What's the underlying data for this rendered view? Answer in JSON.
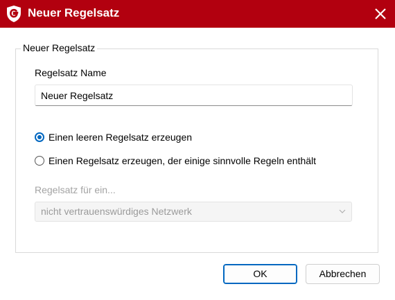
{
  "window": {
    "title": "Neuer Regelsatz",
    "logo_icon": "gdata-shield-icon",
    "close_icon": "close-icon",
    "accent_color": "#b2000f"
  },
  "group": {
    "legend": "Neuer Regelsatz"
  },
  "name_field": {
    "label": "Regelsatz Name",
    "value": "Neuer Regelsatz"
  },
  "options": {
    "empty_ruleset": {
      "label": "Einen leeren Regelsatz erzeugen",
      "checked": true
    },
    "sensible_rules": {
      "label": "Einen Regelsatz erzeugen, der einige sinnvolle Regeln enthält",
      "checked": false
    }
  },
  "network_select": {
    "label": "Regelsatz für ein...",
    "selected": "nicht vertrauenswürdiges Netzwerk",
    "disabled": true
  },
  "buttons": {
    "ok": "OK",
    "cancel": "Abbrechen"
  },
  "colors": {
    "radio_accent": "#0067c0",
    "disabled_text": "#a3a3a3"
  }
}
